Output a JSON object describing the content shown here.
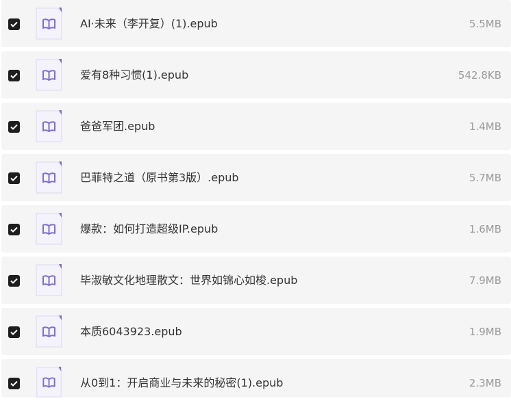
{
  "files": [
    {
      "name": "AI·未来（李开复）(1).epub",
      "size": "5.5MB",
      "checked": true,
      "icon": "book-icon"
    },
    {
      "name": "爱有8种习惯(1).epub",
      "size": "542.8KB",
      "checked": true,
      "icon": "book-icon"
    },
    {
      "name": "爸爸军团.epub",
      "size": "1.4MB",
      "checked": true,
      "icon": "book-icon"
    },
    {
      "name": "巴菲特之道（原书第3版）.epub",
      "size": "5.7MB",
      "checked": true,
      "icon": "book-icon"
    },
    {
      "name": "爆款：如何打造超级IP.epub",
      "size": "1.6MB",
      "checked": true,
      "icon": "book-icon"
    },
    {
      "name": "毕淑敏文化地理散文：世界如锦心如梭.epub",
      "size": "7.9MB",
      "checked": true,
      "icon": "book-icon"
    },
    {
      "name": "本质6043923.epub",
      "size": "1.9MB",
      "checked": true,
      "icon": "book-icon"
    },
    {
      "name": "从0到1：开启商业与未来的秘密(1).epub",
      "size": "2.3MB",
      "checked": true,
      "icon": "book-icon"
    }
  ],
  "colors": {
    "row_bg": "#f5f5f6",
    "checkbox": "#1e1e1e",
    "icon_accent": "#7b6fcf",
    "name_text": "#333333",
    "size_text": "#9a9a9a"
  }
}
